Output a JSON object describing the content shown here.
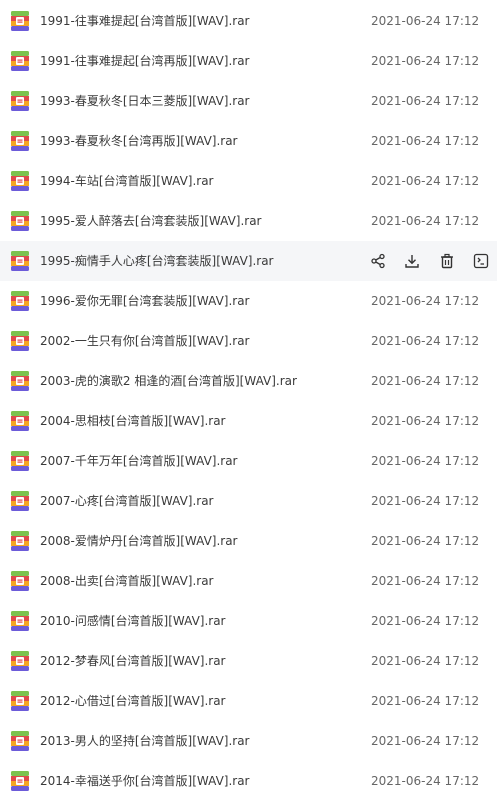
{
  "colors": {
    "accent_blue": "#2a6fd1",
    "archive_red": "#e0474c",
    "archive_green": "#7cc24f",
    "archive_orange": "#f5a623",
    "archive_purple": "#6c5bd9",
    "hover_background": "#f5f6f8",
    "text": "#3a3a3a",
    "date_text": "#666666"
  },
  "icons": {
    "file": "rar-archive-icon",
    "share": "share-icon",
    "download": "download-icon",
    "delete": "trash-icon",
    "more": "terminal-icon"
  },
  "files": [
    {
      "name": "1991-往事难提起[台湾首版][WAV].rar",
      "date": "2021-06-24 17:12"
    },
    {
      "name": "1991-往事难提起[台湾再版][WAV].rar",
      "date": "2021-06-24 17:12"
    },
    {
      "name": "1993-春夏秋冬[日本三菱版][WAV].rar",
      "date": "2021-06-24 17:12"
    },
    {
      "name": "1993-春夏秋冬[台湾再版][WAV].rar",
      "date": "2021-06-24 17:12"
    },
    {
      "name": "1994-车站[台湾首版][WAV].rar",
      "date": "2021-06-24 17:12"
    },
    {
      "name": "1995-爱人醉落去[台湾套装版][WAV].rar",
      "date": "2021-06-24 17:12"
    },
    {
      "name": "1995-痴情手人心疼[台湾套装版][WAV].rar",
      "date": "",
      "hovered": true
    },
    {
      "name": "1996-爱你无罪[台湾套装版][WAV].rar",
      "date": "2021-06-24 17:12"
    },
    {
      "name": "2002-一生只有你[台湾首版][WAV].rar",
      "date": "2021-06-24 17:12"
    },
    {
      "name": "2003-虎的演歌2 相逢的酒[台湾首版][WAV].rar",
      "date": "2021-06-24 17:12"
    },
    {
      "name": "2004-思相枝[台湾首版][WAV].rar",
      "date": "2021-06-24 17:12"
    },
    {
      "name": "2007-千年万年[台湾首版][WAV].rar",
      "date": "2021-06-24 17:12"
    },
    {
      "name": "2007-心疼[台湾首版][WAV].rar",
      "date": "2021-06-24 17:12"
    },
    {
      "name": "2008-爱情炉丹[台湾首版][WAV].rar",
      "date": "2021-06-24 17:12"
    },
    {
      "name": "2008-出卖[台湾首版][WAV].rar",
      "date": "2021-06-24 17:12"
    },
    {
      "name": "2010-问感情[台湾首版][WAV].rar",
      "date": "2021-06-24 17:12"
    },
    {
      "name": "2012-梦春风[台湾首版][WAV].rar",
      "date": "2021-06-24 17:12"
    },
    {
      "name": "2012-心借过[台湾首版][WAV].rar",
      "date": "2021-06-24 17:12"
    },
    {
      "name": "2013-男人的坚持[台湾首版][WAV].rar",
      "date": "2021-06-24 17:12"
    },
    {
      "name": "2014-幸福送乎你[台湾首版][WAV].rar",
      "date": "2021-06-24 17:12"
    }
  ]
}
